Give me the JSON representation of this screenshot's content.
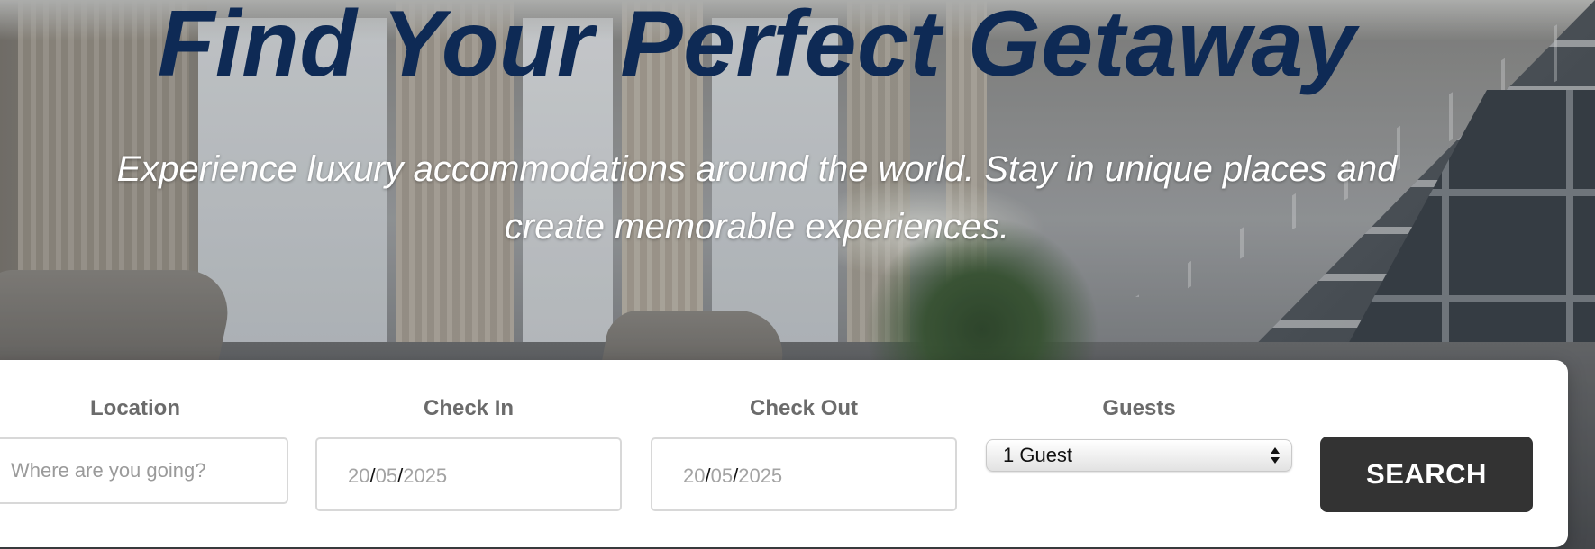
{
  "hero": {
    "title": "Find Your Perfect Getaway",
    "subtitle": "Experience luxury accommodations around the world. Stay in unique places and create memorable experiences."
  },
  "search": {
    "location": {
      "label": "Location",
      "placeholder": "Where are you going?",
      "value": ""
    },
    "check_in": {
      "label": "Check In",
      "day": "20",
      "month": "05",
      "year": "2025",
      "separator": "/"
    },
    "check_out": {
      "label": "Check Out",
      "day": "20",
      "month": "05",
      "year": "2025",
      "separator": "/"
    },
    "guests": {
      "label": "Guests",
      "selected": "1 Guest",
      "icon": "select-arrows-icon"
    },
    "button_label": "SEARCH"
  },
  "colors": {
    "title": "#0e2a55",
    "subtitle": "#ffffff",
    "button_bg": "#333333",
    "label": "#6b6b6b",
    "panel_bg": "#ffffff"
  }
}
